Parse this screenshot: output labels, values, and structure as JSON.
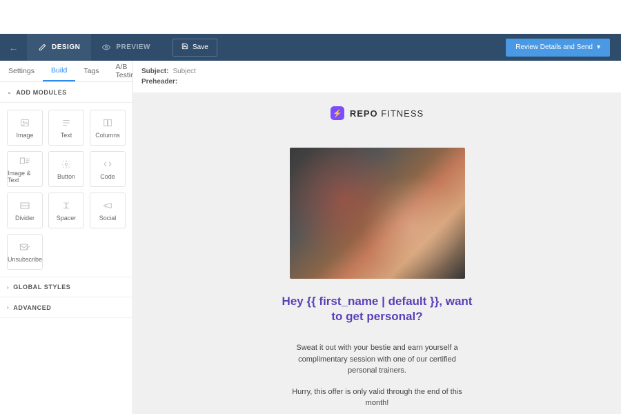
{
  "toolbar": {
    "design_label": "DESIGN",
    "preview_label": "PREVIEW",
    "save_label": "Save",
    "review_label": "Review Details and Send"
  },
  "tabs": {
    "settings": "Settings",
    "build": "Build",
    "tags": "Tags",
    "ab": "A/B Testing"
  },
  "sections": {
    "add_modules": "ADD MODULES",
    "global_styles": "GLOBAL STYLES",
    "advanced": "ADVANCED"
  },
  "modules": [
    {
      "label": "Image",
      "icon": "image"
    },
    {
      "label": "Text",
      "icon": "text"
    },
    {
      "label": "Columns",
      "icon": "columns"
    },
    {
      "label": "Image & Text",
      "icon": "imagetext"
    },
    {
      "label": "Button",
      "icon": "button"
    },
    {
      "label": "Code",
      "icon": "code"
    },
    {
      "label": "Divider",
      "icon": "divider"
    },
    {
      "label": "Spacer",
      "icon": "spacer"
    },
    {
      "label": "Social",
      "icon": "social"
    },
    {
      "label": "Unsubscribe",
      "icon": "unsubscribe"
    }
  ],
  "meta": {
    "subject_label": "Subject:",
    "subject_value": "Subject",
    "preheader_label": "Preheader:"
  },
  "email": {
    "brand_bold": "REPO",
    "brand_light": "FITNESS",
    "headline": "Hey {{ first_name | default }}, want to get personal?",
    "body1": "Sweat it out with your bestie and earn yourself a complimentary session with one of our certified personal trainers.",
    "body2": "Hurry, this offer is only valid through the end of this month!"
  }
}
